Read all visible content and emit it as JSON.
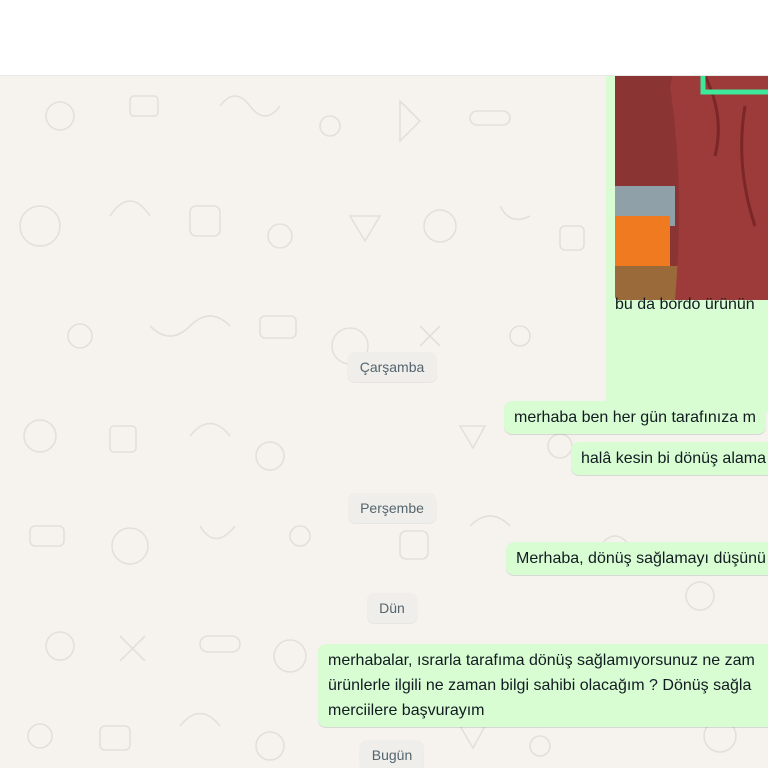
{
  "chat": {
    "media_message": {
      "caption": "bu da bordo ürünün"
    },
    "dates": {
      "wednesday": "Çarşamba",
      "thursday": "Perşembe",
      "yesterday": "Dün",
      "today": "Bugün"
    },
    "messages": [
      {
        "text": "merhaba ben her gün tarafınıza m"
      },
      {
        "text": "halâ kesin bi dönüş alama"
      },
      {
        "text": "Merhaba, dönüş sağlamayı düşünü"
      },
      {
        "lines": [
          "merhabalar, ısrarla tarafıma dönüş sağlamıyorsunuz ne zam",
          "ürünlerle ilgili ne zaman bilgi sahibi olacağım ? Dönüş sağla",
          "merciilere başvurayım"
        ]
      }
    ]
  },
  "colors": {
    "chat_background": "#f6f3ef",
    "outgoing_bubble": "#d9fdd3",
    "date_chip": "#f0eeea",
    "text": "#111b21",
    "muted_text": "#54656f",
    "sticker_outline": "#3ee89a"
  },
  "icons": [
    "doodle-wallpaper"
  ]
}
